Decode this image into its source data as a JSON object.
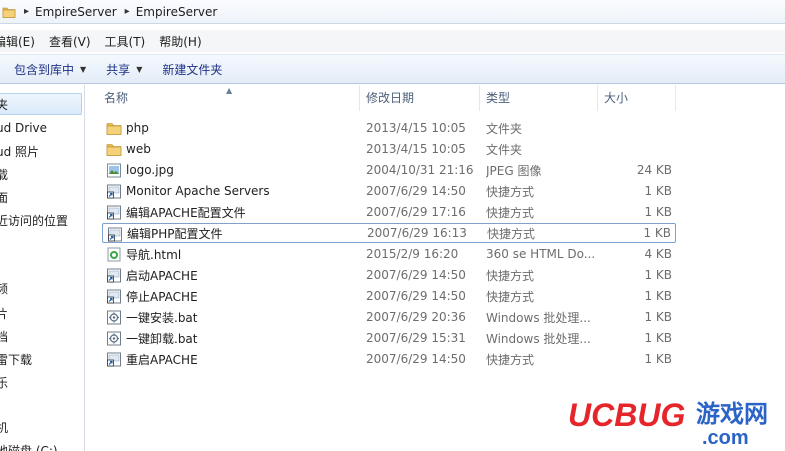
{
  "address": {
    "crumbs": [
      "EmpireServer",
      "EmpireServer"
    ]
  },
  "menu": [
    "编辑(E)",
    "查看(V)",
    "工具(T)",
    "帮助(H)"
  ],
  "toolbar": {
    "include_label": "包含到库中",
    "share_label": "共享",
    "new_folder_label": "新建文件夹"
  },
  "nav": {
    "items": [
      "夹",
      "ud Drive",
      "ud 照片",
      "载",
      "面",
      "近访问的位置",
      "频",
      "片",
      "档",
      "雷下载",
      "乐",
      "机",
      "地磁盘 (C:)"
    ]
  },
  "columns": {
    "name": "名称",
    "date": "修改日期",
    "type": "类型",
    "size": "大小"
  },
  "files": [
    {
      "icon": "folder-icon",
      "name": "php",
      "date": "2013/4/15 10:05",
      "type": "文件夹",
      "size": ""
    },
    {
      "icon": "folder-icon",
      "name": "web",
      "date": "2013/4/15 10:05",
      "type": "文件夹",
      "size": ""
    },
    {
      "icon": "image-file-icon",
      "name": "logo.jpg",
      "date": "2004/10/31 21:16",
      "type": "JPEG 图像",
      "size": "24 KB"
    },
    {
      "icon": "shortcut-icon",
      "name": "Monitor Apache Servers",
      "date": "2007/6/29 14:50",
      "type": "快捷方式",
      "size": "1 KB"
    },
    {
      "icon": "shortcut-icon",
      "name": "编辑APACHE配置文件",
      "date": "2007/6/29 17:16",
      "type": "快捷方式",
      "size": "1 KB"
    },
    {
      "icon": "shortcut-icon",
      "name": "编辑PHP配置文件",
      "date": "2007/6/29 16:13",
      "type": "快捷方式",
      "size": "1 KB"
    },
    {
      "icon": "html-file-icon",
      "name": "导航.html",
      "date": "2015/2/9 16:20",
      "type": "360 se HTML Do...",
      "size": "4 KB"
    },
    {
      "icon": "shortcut-icon",
      "name": "启动APACHE",
      "date": "2007/6/29 14:50",
      "type": "快捷方式",
      "size": "1 KB"
    },
    {
      "icon": "shortcut-icon",
      "name": "停止APACHE",
      "date": "2007/6/29 14:50",
      "type": "快捷方式",
      "size": "1 KB"
    },
    {
      "icon": "batch-file-icon",
      "name": "一键安装.bat",
      "date": "2007/6/29 20:36",
      "type": "Windows 批处理...",
      "size": "1 KB"
    },
    {
      "icon": "batch-file-icon",
      "name": "一键卸载.bat",
      "date": "2007/6/29 15:31",
      "type": "Windows 批处理...",
      "size": "1 KB"
    },
    {
      "icon": "shortcut-icon",
      "name": "重启APACHE",
      "date": "2007/6/29 14:50",
      "type": "快捷方式",
      "size": "1 KB"
    }
  ],
  "watermark": {
    "brand": "UCBUG",
    "cn": "游戏网",
    "domain": ".com"
  },
  "colors": {
    "folder": "#e9b949",
    "logo_red": "#e5252a",
    "logo_blue": "#2b64c6"
  }
}
